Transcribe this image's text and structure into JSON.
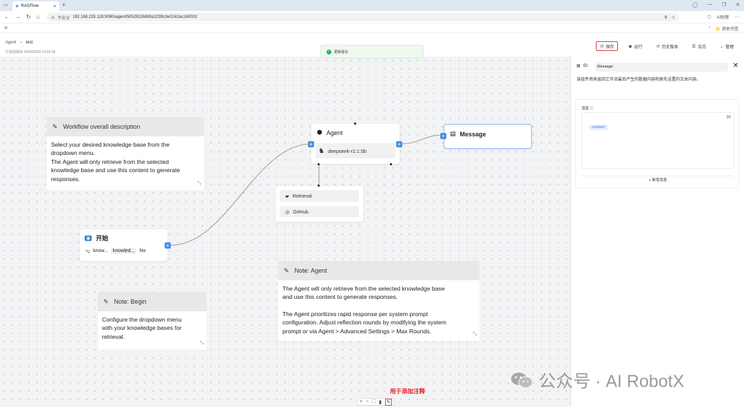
{
  "browser": {
    "tab_title": "RAGFlow",
    "insecure_label": "不安全",
    "url": "192.168.233.128:9080/agent/5052922680fa11f39c3e0242ac160002",
    "bookmarks_right": "其他书签",
    "profile_label": "AI助理"
  },
  "header": {
    "breadcrumb_root": "Agent",
    "breadcrumb_current": "test",
    "saved_at": "已自动保存 24/08/2025 23:03:08",
    "save_label": "保存",
    "run_label": "运行",
    "history_label": "历史版本",
    "log_label": "日志",
    "manage_label": "管理"
  },
  "toast": {
    "text": "更新成功"
  },
  "notes": [
    {
      "title": "Workflow overall description",
      "body_lines": [
        "Select your desired knowledge base from the",
        "dropdown menu.",
        "The Agent will only retrieve from the selected",
        "knowledge base and use this content  to generate",
        "responses."
      ]
    },
    {
      "title": "Note: Begin",
      "body_lines": [
        "Configure the dropdown menu",
        "with your knowledge bases for",
        "retrieval."
      ]
    },
    {
      "title": "Note: Agent",
      "body_lines": [
        "The Agent will only retrieve from the selected knowledge base",
        "and use this content  to generate responses.",
        "",
        "The Agent prioritizes rapid response per system prompt",
        "configuration. Adjust reflection rounds by modifying the system",
        "prompt or via Agent > Advanced Settings > Max Rounds."
      ]
    }
  ],
  "nodes": {
    "agent": {
      "title": "Agent",
      "model": "deepseek-r1:1.5b"
    },
    "message": {
      "title": "Message"
    },
    "begin": {
      "title": "开始",
      "param_name": "know...",
      "param_value": "knowled...",
      "param_flag": "No"
    },
    "tools": [
      "Retrieval",
      "GitHub"
    ]
  },
  "panel": {
    "id_label": "ID:",
    "id_value": "Message",
    "description": "该组件用来返回工作流最后产生的数据内容和原先设置的文本内容。",
    "message_label": "消息",
    "variable_tag": "content",
    "braces_icon": "{x}",
    "add_message_label": "+ 新增消息"
  },
  "annotation": "用于添加注释",
  "watermark": "公众号 · AI RobotX"
}
